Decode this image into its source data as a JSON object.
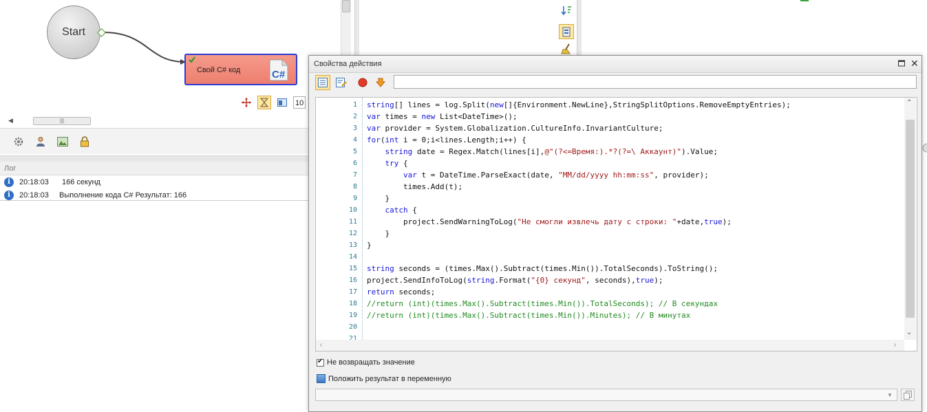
{
  "canvas": {
    "start_label": "Start",
    "action_label": "Свой C# код",
    "zoom_value": "10"
  },
  "log": {
    "title": "Лог",
    "entries": [
      {
        "time": "20:18:03",
        "message": "166 секунд"
      },
      {
        "time": "20:18:03",
        "message": "Выполнение кода C#  Результат: 166"
      }
    ]
  },
  "dialog": {
    "title": "Свойства действия",
    "search_value": "",
    "line_numbers": [
      "1",
      "2",
      "3",
      "4",
      "5",
      "6",
      "7",
      "8",
      "9",
      "10",
      "11",
      "12",
      "13",
      "14",
      "15",
      "16",
      "17",
      "18",
      "19",
      "20",
      "21"
    ],
    "code_lines": [
      "string[] lines = log.Split(new[]{Environment.NewLine},StringSplitOptions.RemoveEmptyEntries);",
      "var times = new List<DateTime>();",
      "var provider = System.Globalization.CultureInfo.InvariantCulture;",
      "for(int i = 0;i<lines.Length;i++) {",
      "    string date = Regex.Match(lines[i],@\"(?<=Время:).*?(?=\\ Аккаунт)\").Value;",
      "    try {",
      "        var t = DateTime.ParseExact(date, \"MM/dd/yyyy hh:mm:ss\", provider);",
      "        times.Add(t);",
      "    }",
      "    catch {",
      "        project.SendWarningToLog(\"Не смогли извлечь дату с строки: \"+date,true);",
      "    }",
      "}",
      "",
      "string seconds = (times.Max().Subtract(times.Min()).TotalSeconds).ToString();",
      "project.SendInfoToLog(string.Format(\"{0} секунд\", seconds),true);",
      "return seconds;",
      "//return (int)(times.Max().Subtract(times.Min()).TotalSeconds); // В секундах",
      "//return (int)(times.Max().Subtract(times.Min()).Minutes); // В минутах",
      "",
      ""
    ],
    "no_return_label": "Не возвращать значение",
    "no_return_checked": true,
    "save_result_label": "Положить результат в переменную",
    "variable_value": ""
  }
}
